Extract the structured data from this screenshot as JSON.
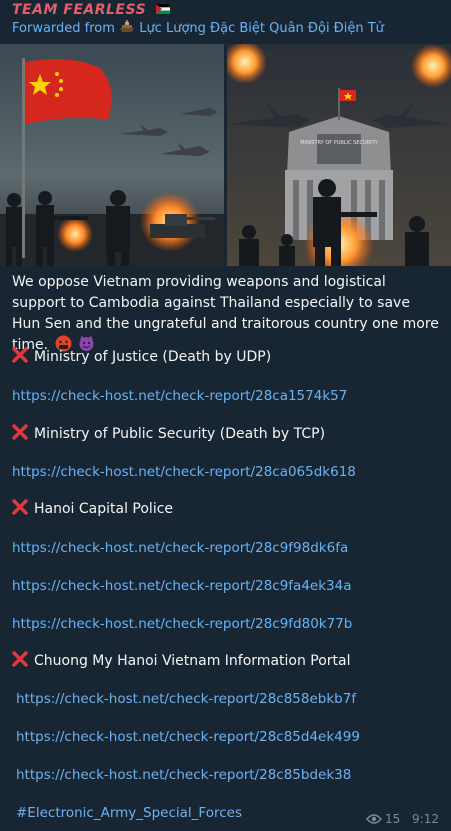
{
  "header": {
    "channel_name": "TEAM FEARLESS",
    "forwarded_prefix": "Forwarded from",
    "forwarded_source": "Lực Lượng Đặc Biệt Quân Đội Điện Tử"
  },
  "media": {
    "left_image": "soldiers-with-red-flag-and-jets",
    "right_image": "soldiers-attacking-ministry-of-public-security-building",
    "building_sign": "MINISTRY OF PUBLIC SECURITY"
  },
  "message": {
    "intro": "We oppose Vietnam providing weapons and logistical support to Cambodia against Thailand especially to save Hun Sen and the ungrateful and traitorous country one more time."
  },
  "targets": [
    {
      "label": "Ministry of Justice (Death by UDP)",
      "links": [
        "https://check-host.net/check-report/28ca1574k57"
      ]
    },
    {
      "label": "Ministry of Public Security (Death by TCP)",
      "links": [
        "https://check-host.net/check-report/28ca065dk618"
      ]
    },
    {
      "label": "Hanoi Capital Police",
      "links": [
        "https://check-host.net/check-report/28c9f98dk6fa",
        "https://check-host.net/check-report/28c9fa4ek34a",
        "https://check-host.net/check-report/28c9fd80k77b"
      ]
    },
    {
      "label": "Chuong My Hanoi Vietnam Information Portal",
      "links": [
        "https://check-host.net/check-report/28c858ebkb7f",
        "https://check-host.net/check-report/28c85d4ek499",
        "https://check-host.net/check-report/28c85bdek38"
      ]
    }
  ],
  "hashtag": "#Electronic_Army_Special_Forces",
  "footer": {
    "views": "15",
    "time": "9:12"
  },
  "colors": {
    "background": "#182533",
    "sender": "#e45f6c",
    "link": "#6ab3f3",
    "meta": "#7b8b9b",
    "cross": "#e0383e"
  }
}
